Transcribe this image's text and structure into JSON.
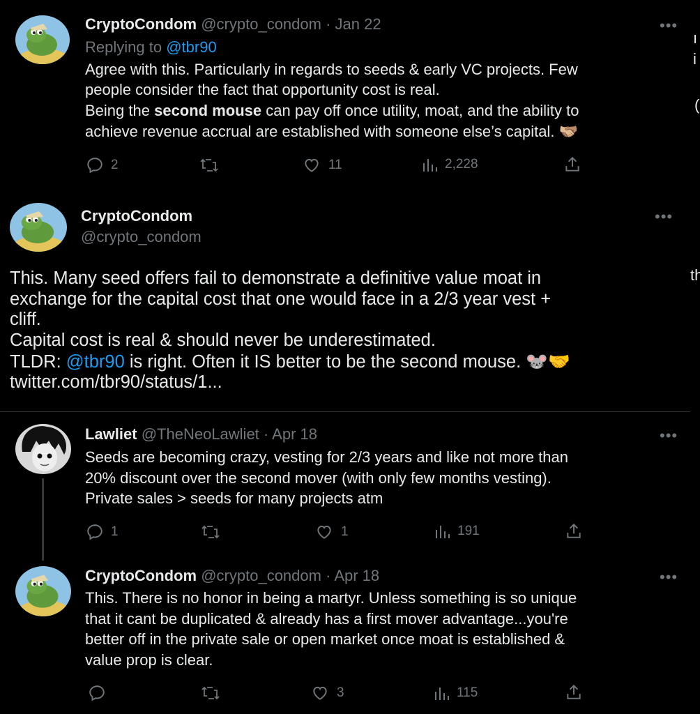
{
  "tweet1": {
    "name": "CryptoCondom",
    "handle": "@crypto_condom",
    "sep": "·",
    "date": "Jan 22",
    "replying_prefix": "Replying to",
    "replying_handle": "@tbr90",
    "line1": "Agree with this. Particularly in regards to seeds & early VC projects. Few",
    "line2": "people consider the fact that opportunity cost is real.",
    "line3_a": "Being the",
    "line3_bold": "second mouse",
    "line3_b": "can pay off once utility, moat, and the ability to",
    "line4": "achieve revenue accrual are established with someone else’s capital.",
    "emoji": "🫱🏼‍🫲🏽",
    "replies": "2",
    "retweets": "",
    "likes": "11",
    "views": "2,228"
  },
  "tweet2": {
    "name": "CryptoCondom",
    "handle": "@crypto_condom",
    "line1": "This. Many seed offers fail to demonstrate a definitive value moat in",
    "line2": "exchange for the capital cost that one would face in a 2/3 year vest +",
    "line3": "cliff.",
    "line4": "Capital cost is real & should never be underestimated.",
    "line5_a": "TLDR:",
    "line5_mention": "@tbr90",
    "line5_b": "is right. Often it IS better to be the second mouse.",
    "line5_emoji": "🐭🤝",
    "link": "twitter.com/tbr90/status/1..."
  },
  "tweet3": {
    "name": "Lawliet",
    "handle": "@TheNeoLawliet",
    "sep": "·",
    "date": "Apr 18",
    "line1": "Seeds are becoming crazy, vesting for 2/3 years and like not more than",
    "line2": "20% discount over the second mover (with only few months vesting).",
    "line3": "Private sales > seeds for many projects atm",
    "replies": "1",
    "likes": "1",
    "views": "191"
  },
  "tweet4": {
    "name": "CryptoCondom",
    "handle": "@crypto_condom",
    "sep": "·",
    "date": "Apr 18",
    "line1": "This. There is no honor in being a martyr. Unless something is so unique",
    "line2": "that it cant be duplicated & already has a first mover advantage...you're",
    "line3": "better off in the private sale or open market once moat is established &",
    "line4": "value prop is clear.",
    "likes": "3",
    "views": "115"
  },
  "more_glyph": "•••",
  "edge": {
    "a": "ı",
    "b": "i",
    "c": "(",
    "d": "th"
  },
  "colors": {
    "background": "#000000",
    "text": "#e7e9ea",
    "muted": "#71767b",
    "link": "#1d9bf0",
    "divider": "#2f3336"
  }
}
